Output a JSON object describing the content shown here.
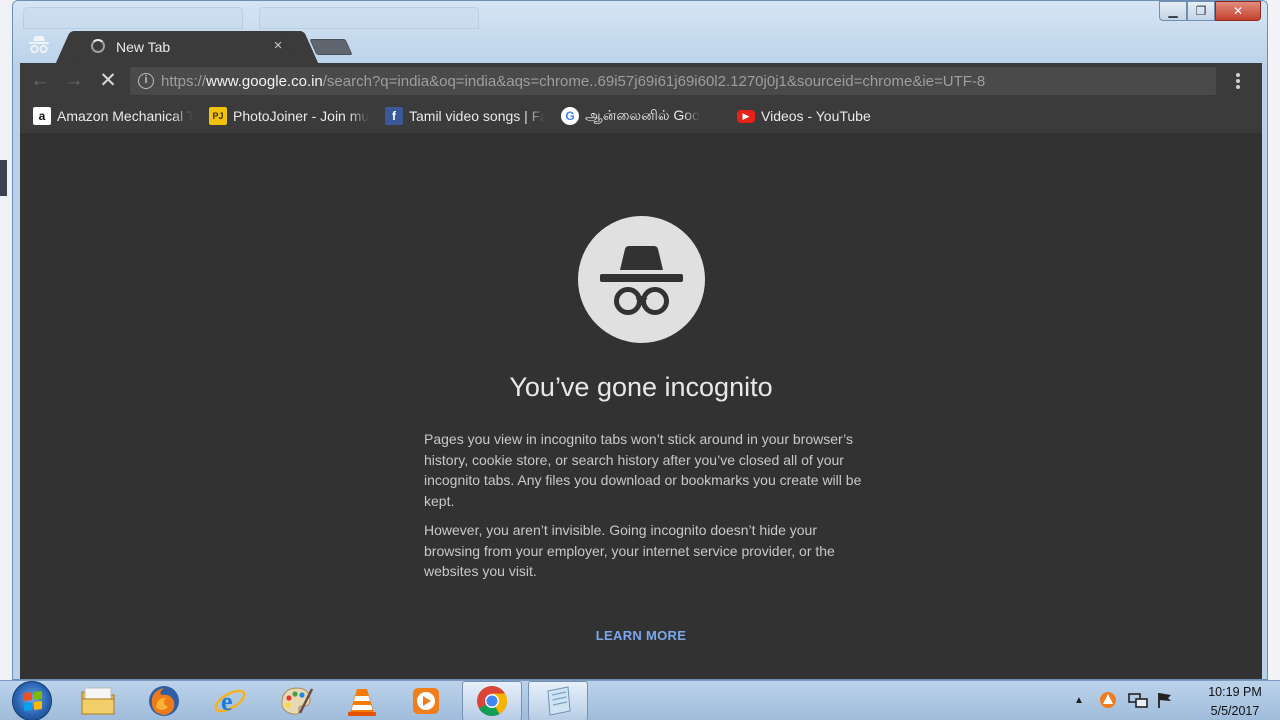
{
  "window": {
    "tab_title": "New Tab",
    "tab_close": "×",
    "caption_minimize": "▁",
    "caption_maximize": "❐",
    "caption_close": "✕"
  },
  "toolbar": {
    "back": "←",
    "forward": "→",
    "reload": "✕",
    "url_prefix": "https://",
    "url_host": "www.google.co.in",
    "url_rest": "/search?q=india&oq=india&aqs=chrome..69i57j69i61j69i60l2.1270j0j1&sourceid=chrome&ie=UTF-8",
    "star": "☆"
  },
  "bookmarks": [
    {
      "label": "Amazon Mechanical T",
      "favicon": "a",
      "favicon_bg": "#ffffff",
      "favicon_fg": "#111111"
    },
    {
      "label": "PhotoJoiner - Join mu",
      "favicon": "PJ",
      "favicon_bg": "#f4c20d",
      "favicon_fg": "#3a2f00"
    },
    {
      "label": "Tamil video songs | Fa",
      "favicon": "f",
      "favicon_bg": "#3b5998",
      "favicon_fg": "#ffffff"
    },
    {
      "label": "ஆன்லைனில் Goo",
      "favicon": "G",
      "favicon_bg": "#ffffff",
      "favicon_fg": "#4285f4"
    },
    {
      "label": "Videos - YouTube",
      "favicon": "▶",
      "favicon_bg": "#e62117",
      "favicon_fg": "#ffffff"
    }
  ],
  "content": {
    "heading": "You’ve gone incognito",
    "paragraph1": "Pages you view in incognito tabs won’t stick around in your browser’s history, cookie store, or search history after you’ve closed all of your incognito tabs. Any files you download or bookmarks you create will be kept.",
    "paragraph2": "However, you aren’t invisible. Going incognito doesn’t hide your browsing from your employer, your internet service provider, or the websites you visit.",
    "learn_more": "LEARN MORE"
  },
  "taskbar": {
    "pinned": [
      "windows-explorer",
      "firefox",
      "internet-explorer",
      "paint",
      "vlc",
      "media-player",
      "chrome",
      "notepad"
    ],
    "tray_chevron": "▲",
    "time": "10:19 PM",
    "date": "5/5/2017"
  },
  "colors": {
    "incognito_bg": "#323232",
    "toolbar_bg": "#3b3b3b",
    "link_blue": "#7aa7ee"
  }
}
